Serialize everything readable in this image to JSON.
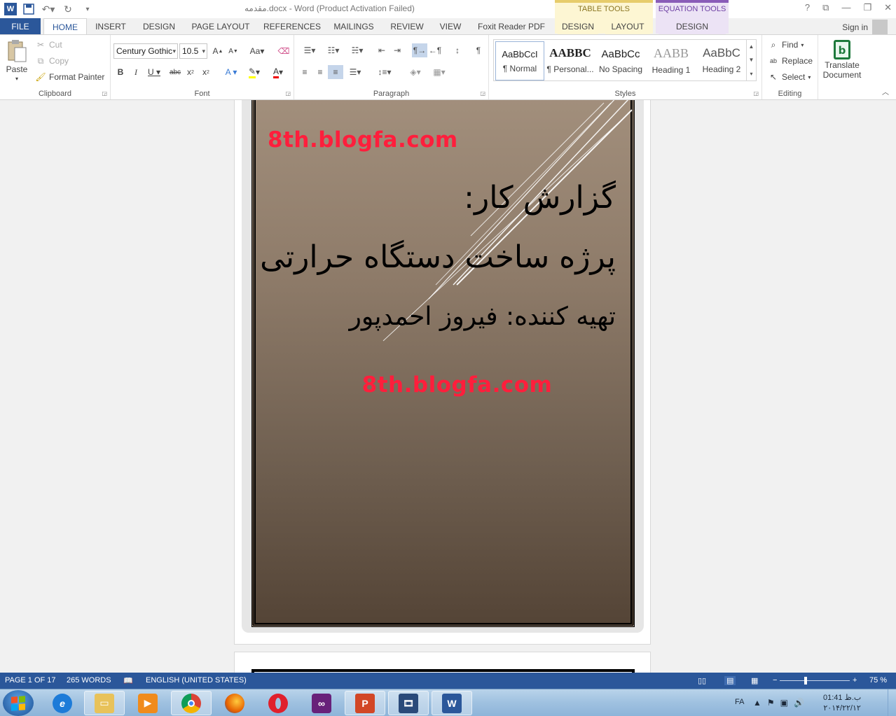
{
  "titlebar": {
    "doc_title": "مقدمه.docx - Word (Product Activation Failed)",
    "context_table_tools": "TABLE TOOLS",
    "context_equation_tools": "EQUATION TOOLS",
    "help": "?",
    "restore_ribbon": "⧉",
    "minimize": "—",
    "maximize": "❐",
    "close": "✕"
  },
  "tabs": {
    "file": "FILE",
    "home": "HOME",
    "insert": "INSERT",
    "design": "DESIGN",
    "page_layout": "PAGE LAYOUT",
    "references": "REFERENCES",
    "mailings": "MAILINGS",
    "review": "REVIEW",
    "view": "VIEW",
    "foxit": "Foxit Reader PDF",
    "table_design": "DESIGN",
    "table_layout": "LAYOUT",
    "equation_design": "DESIGN",
    "signin": "Sign in"
  },
  "clipboard": {
    "paste": "Paste",
    "cut": "Cut",
    "copy": "Copy",
    "format_painter": "Format Painter",
    "label": "Clipboard"
  },
  "font": {
    "name": "Century Gothic",
    "size": "10.5",
    "label": "Font",
    "change_case": "Aa"
  },
  "paragraph": {
    "label": "Paragraph"
  },
  "styles": {
    "label": "Styles",
    "items": [
      {
        "sample": "AaBbCcI",
        "name": "¶ Normal"
      },
      {
        "sample": "AABBC",
        "name": "¶ Personal..."
      },
      {
        "sample": "AaBbCc",
        "name": "No Spacing"
      },
      {
        "sample": "AABB",
        "name": "Heading 1"
      },
      {
        "sample": "AaBbC",
        "name": "Heading 2"
      }
    ]
  },
  "editing": {
    "find": "Find",
    "replace": "Replace",
    "select": "Select",
    "label": "Editing"
  },
  "translate": {
    "line1": "Translate",
    "line2": "Document"
  },
  "document": {
    "blog_top": "8th.blogfa.com",
    "title_line1": "گزارش کار:",
    "title_line2": "پرژه ساخت دستگاه حرارتی",
    "title_line3": "تهیه کننده: فیروز احمدپور",
    "blog_bottom": "8th.blogfa.com"
  },
  "status": {
    "page": "PAGE 1 OF 17",
    "words": "265 WORDS",
    "language": "ENGLISH (UNITED STATES)",
    "zoom": "75 %"
  },
  "taskbar": {
    "lang": "FA",
    "time": "01:41 ب.ظ",
    "date": "۲۰۱۴/۲۲/۱۲"
  },
  "colors": {
    "accent": "#2b579a",
    "blog_red": "#ff1e3c"
  }
}
